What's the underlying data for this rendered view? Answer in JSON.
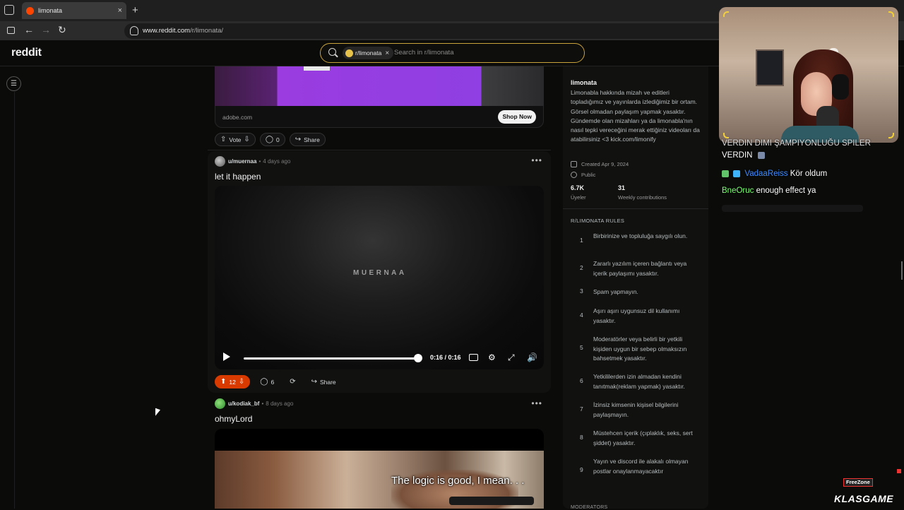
{
  "browser": {
    "tab_title": "limonata",
    "tab_close": "×",
    "new_tab": "+",
    "url_domain": "www.reddit.com",
    "url_path": "/r/limonata/"
  },
  "reddit": {
    "logo": "reddit",
    "search": {
      "chip_label": "r/limonata",
      "chip_close": "×",
      "placeholder": "Search in r/limonata"
    }
  },
  "ad": {
    "domain": "adobe.com",
    "cta": "Shop Now",
    "actions": {
      "vote": "Vote",
      "comments": "0",
      "share": "Share"
    }
  },
  "posts": [
    {
      "author": "u/muernaa",
      "separator": "•",
      "age": "4 days ago",
      "title": "let it happen",
      "watermark": "MUERNAA",
      "video_time": "0:16 / 0:16",
      "progress": 1.0,
      "votes": "12",
      "comments": "6",
      "share": "Share"
    },
    {
      "author": "u/kodiak_bf",
      "separator": "•",
      "age": "8 days ago",
      "title": "ohmyLord",
      "subtitle": "The logic is good, I mean. . ."
    }
  ],
  "sidebar": {
    "name": "limonata",
    "description": "Limonabla hakkında mizah ve editleri topladığımız ve yayınlarda izlediğimiz bir ortam. Görsel olmadan paylaşım yapmak yasaktır. Gündemde olan mizahları ya da limonabla'nın nasıl tepki vereceğini merak ettiğiniz videoları da atabilirsiniz <3 kick.com/limonify",
    "created": "Created Apr 9, 2024",
    "visibility": "Public",
    "members_count": "6.7K",
    "members_label": "Üyeler",
    "contrib_count": "31",
    "contrib_label": "Weekly contributions",
    "rules_title": "R/LIMONATA RULES",
    "rules": [
      {
        "num": "1",
        "text": "Birbirinize ve topluluğa saygılı olun."
      },
      {
        "num": "2",
        "text": "Zararlı yazılım içeren bağlantı veya içerik paylaşımı yasaktır."
      },
      {
        "num": "3",
        "text": "Spam yapmayın."
      },
      {
        "num": "4",
        "text": "Aşırı aşırı uygunsuz dil kullanımı yasaktır."
      },
      {
        "num": "5",
        "text": "Moderatörler veya belirli bir yetkili kişiden uygun bir sebep olmaksızın bahsetmek yasaktır."
      },
      {
        "num": "6",
        "text": "Yetkililerden izin almadan kendini tanıtmak(reklam yapmak) yasaktır."
      },
      {
        "num": "7",
        "text": "İzinsiz kimsenin kişisel bilgilerini paylaşmayın."
      },
      {
        "num": "8",
        "text": "Müstehcen içerik (çıplaklık, seks, sert şiddet) yasaktır."
      },
      {
        "num": "9",
        "text": "Yayın ve discord ile alakalı olmayan postlar onaylanmayacaktır"
      }
    ],
    "mods_title": "MODERATORS"
  },
  "overlay": {
    "chat": [
      {
        "user": "",
        "text": "VERDIN DIMI ŞAMPIYONLUĞU SPILER"
      },
      {
        "user": "",
        "text": "VERDIN"
      },
      {
        "user": "VadaaReiss",
        "text": "Kör oldum"
      },
      {
        "user": "BneOruc",
        "text": "enough effect ya"
      }
    ],
    "freezone": "FreeZone",
    "brand": "KLASGAME"
  },
  "colors": {
    "accent_search": "#c8a23a",
    "upvote_active": "#d93a00",
    "username_blue": "#3f8cff",
    "username_green": "#7cff72"
  }
}
